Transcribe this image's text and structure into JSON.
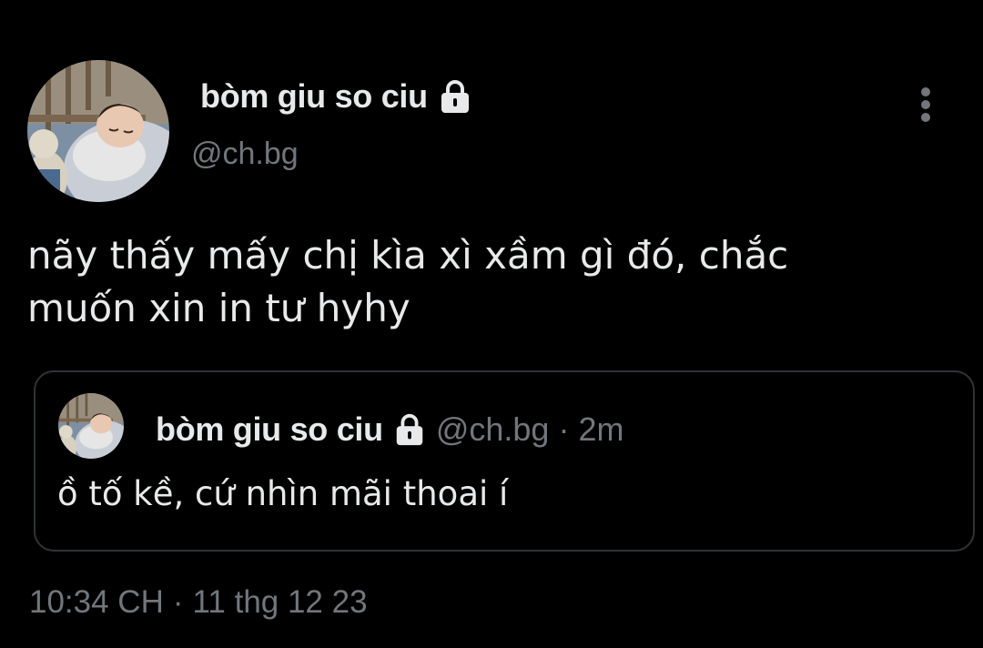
{
  "tweet": {
    "author": {
      "display_name": "bòm giu so ciu",
      "handle": "@ch.bg",
      "protected_icon": "lock-icon",
      "avatar": "profile-photo"
    },
    "more_icon": "more-vertical-icon",
    "text_lines": [
      "nãy thấy mấy chị kìa xì xầm gì đó, chắc",
      "muốn xin in tư hyhy"
    ],
    "quoted": {
      "display_name": "bòm giu so ciu",
      "handle": "@ch.bg",
      "separator": "·",
      "time": "2m",
      "text": "ồ tố kề, cứ nhìn mãi thoai í"
    },
    "timestamp": {
      "time": "10:34 CH",
      "separator": "·",
      "date": "11 thg 12 23"
    }
  },
  "colors": {
    "background": "#000000",
    "primary_text": "#e7e9ea",
    "secondary_text": "#71767b",
    "border": "#2f3336"
  }
}
